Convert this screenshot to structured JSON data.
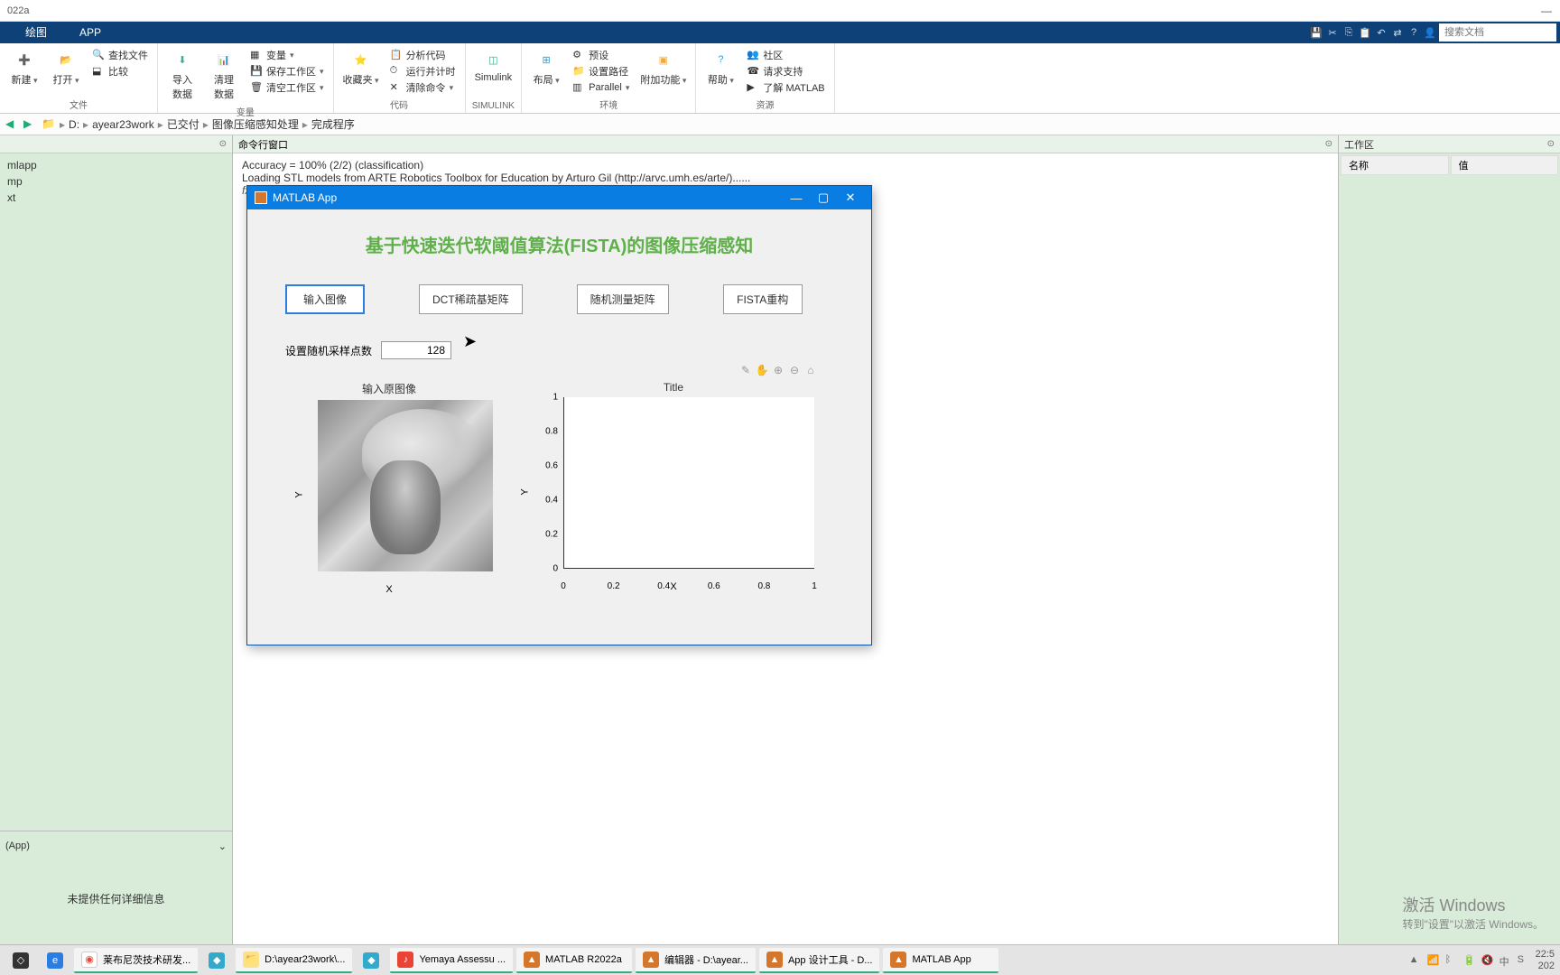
{
  "window_title": "022a",
  "ribbon": {
    "tabs": [
      "绘图",
      "APP"
    ],
    "search_placeholder": "搜索文档"
  },
  "toolstrip": {
    "groups": {
      "file": {
        "label": "文件",
        "new": "新建",
        "open": "打开",
        "find": "查找文件",
        "compare": "比较"
      },
      "variable": {
        "label": "变量",
        "import": "导入\n数据",
        "clean": "清理\n数据",
        "var": "变量",
        "save_ws": "保存工作区",
        "clear_ws": "清空工作区"
      },
      "code": {
        "label": "代码",
        "favorites": "收藏夹",
        "analyze": "分析代码",
        "runtime": "运行并计时",
        "clear_cmd": "清除命令"
      },
      "simulink": {
        "label": "SIMULINK",
        "btn": "Simulink"
      },
      "env": {
        "label": "环境",
        "layout": "布局",
        "prefs": "预设",
        "path": "设置路径",
        "parallel": "Parallel",
        "addons": "附加功能"
      },
      "resources": {
        "label": "资源",
        "help": "帮助",
        "community": "社区",
        "support": "请求支持",
        "learn": "了解 MATLAB"
      }
    }
  },
  "pathbar": {
    "drive": "D:",
    "segs": [
      "ayear23work",
      "已交付",
      "图像压缩感知处理",
      "完成程序"
    ]
  },
  "left_panel": {
    "files": [
      "mlapp",
      "mp",
      "xt"
    ],
    "details_dropdown": "(App)",
    "details_msg": "未提供任何详细信息"
  },
  "command": {
    "title": "命令行窗口",
    "lines": [
      "Accuracy = 100% (2/2) (classification)",
      "Loading STL models from ARTE Robotics Toolbox for Education  by Arturo Gil (http://arvc.umh.es/arte/)......"
    ],
    "prompt_fx": "fx",
    "prompt": ">>"
  },
  "workspace": {
    "title": "工作区",
    "col_name": "名称",
    "col_value": "值"
  },
  "app": {
    "window_title": "MATLAB App",
    "title": "基于快速迭代软阈值算法(FISTA)的图像压缩感知",
    "buttons": {
      "input": "输入图像",
      "dct": "DCT稀疏基矩阵",
      "random": "随机测量矩阵",
      "fista": "FISTA重构"
    },
    "param_label": "设置随机采样点数",
    "param_value": "128",
    "left_plot_title": "输入原图像",
    "right_plot_title": "Title",
    "y_label": "Y",
    "x_label": "X"
  },
  "chart_data": {
    "type": "scatter",
    "title": "Title",
    "xlabel": "X",
    "ylabel": "Y",
    "xlim": [
      0,
      1
    ],
    "ylim": [
      0,
      1
    ],
    "xticks": [
      0,
      0.2,
      0.4,
      0.6,
      0.8,
      1
    ],
    "yticks": [
      0,
      0.2,
      0.4,
      0.6,
      0.8,
      1
    ],
    "series": []
  },
  "activate": {
    "title": "激活 Windows",
    "sub": "转到\"设置\"以激活 Windows。"
  },
  "taskbar": {
    "items": [
      {
        "label": "莱布尼茨技术研发...",
        "color": "#fff"
      },
      {
        "label": "D:\\ayear23work\\...",
        "color": "#fce18b"
      },
      {
        "label": "Yemaya Assessu ...",
        "color": "#e94435"
      },
      {
        "label": "MATLAB R2022a",
        "color": "#d4762c"
      },
      {
        "label": "编辑器 - D:\\ayear...",
        "color": "#d4762c"
      },
      {
        "label": "App 设计工具 - D...",
        "color": "#d4762c"
      },
      {
        "label": "MATLAB App",
        "color": "#d4762c"
      }
    ],
    "time": "22:5",
    "date": "202"
  }
}
